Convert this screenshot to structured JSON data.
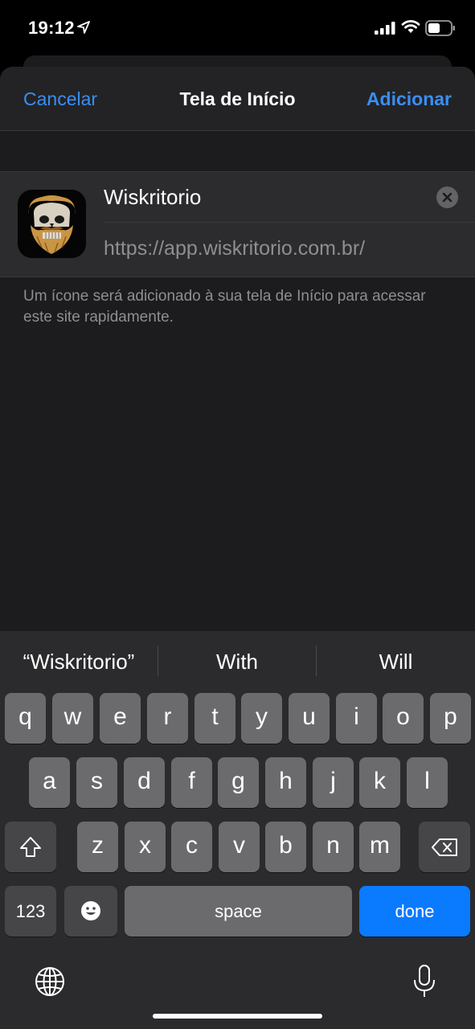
{
  "status_bar": {
    "time": "19:12"
  },
  "nav": {
    "cancel": "Cancelar",
    "title": "Tela de Início",
    "add": "Adicionar"
  },
  "form": {
    "name_value": "Wiskritorio",
    "url": "https://app.wiskritorio.com.br/"
  },
  "helper_text": "Um ícone será adicionado à sua tela de Início para acessar este site rapidamente.",
  "keyboard": {
    "suggestions": [
      "“Wiskritorio”",
      "With",
      "Will"
    ],
    "row1": [
      "q",
      "w",
      "e",
      "r",
      "t",
      "y",
      "u",
      "i",
      "o",
      "p"
    ],
    "row2": [
      "a",
      "s",
      "d",
      "f",
      "g",
      "h",
      "j",
      "k",
      "l"
    ],
    "row3": [
      "z",
      "x",
      "c",
      "v",
      "b",
      "n",
      "m"
    ],
    "numbers_key": "123",
    "space_key": "space",
    "done_key": "done"
  },
  "colors": {
    "accent": "#3a8ef6",
    "done": "#0a7aff"
  },
  "icons": [
    "location-arrow-icon",
    "signal-icon",
    "wifi-icon",
    "battery-icon",
    "clear-icon",
    "shift-icon",
    "backspace-icon",
    "emoji-icon",
    "globe-icon",
    "microphone-icon"
  ]
}
